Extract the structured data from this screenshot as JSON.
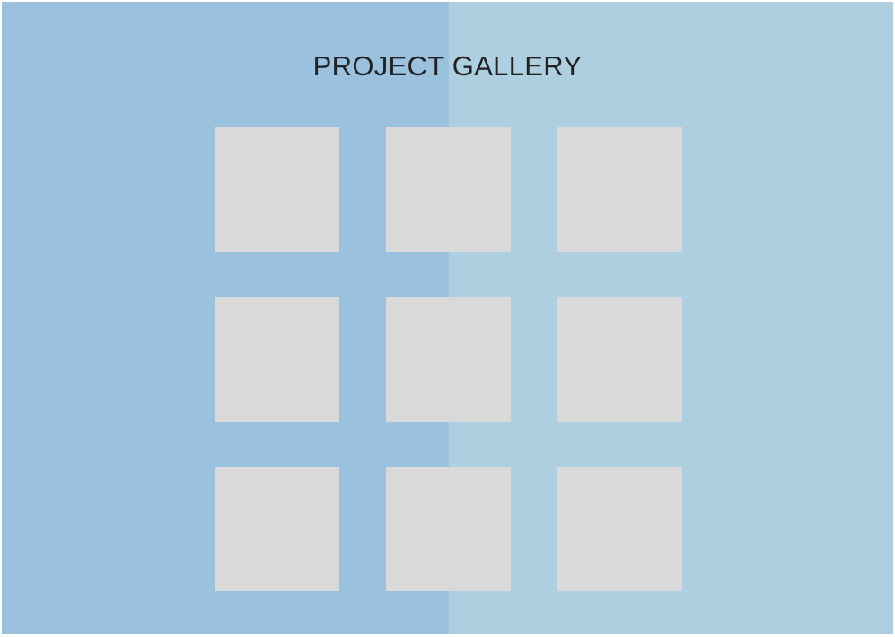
{
  "page": {
    "title": "PROJECT GALLERY"
  },
  "colors": {
    "left_panel": "#9ac1de",
    "right_panel": "#aecfdf",
    "tile": "#d9d9d9",
    "title_text": "#222222"
  },
  "gallery": {
    "rows": 3,
    "columns": 3,
    "tile_count": 9
  }
}
